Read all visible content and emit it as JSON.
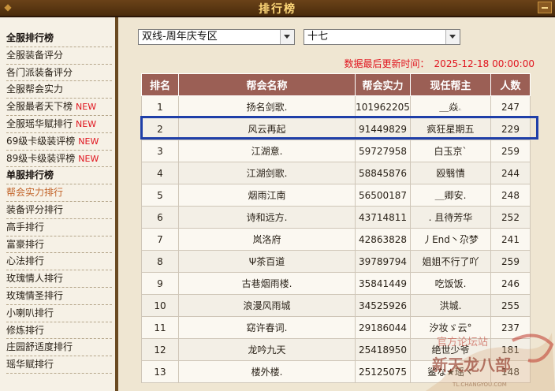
{
  "window": {
    "title": "排行榜"
  },
  "sidebar": {
    "items": [
      {
        "label": "全服排行榜",
        "type": "heading"
      },
      {
        "label": "全服装备评分"
      },
      {
        "label": "各门派装备评分"
      },
      {
        "label": "全服帮会实力"
      },
      {
        "label": "全服最者天下榜",
        "badge": "NEW"
      },
      {
        "label": "全服瑶华赋排行",
        "badge": "NEW"
      },
      {
        "label": "69级卡级装评榜",
        "badge": "NEW"
      },
      {
        "label": "89级卡级装评榜",
        "badge": "NEW"
      },
      {
        "label": "单服排行榜",
        "type": "heading"
      },
      {
        "label": "帮会实力排行",
        "active": true
      },
      {
        "label": "装备评分排行"
      },
      {
        "label": "高手排行"
      },
      {
        "label": "富豪排行"
      },
      {
        "label": "心法排行"
      },
      {
        "label": "玫瑰情人排行"
      },
      {
        "label": "玫瑰情圣排行"
      },
      {
        "label": "小喇叭排行"
      },
      {
        "label": "修炼排行"
      },
      {
        "label": "庄园舒适度排行"
      },
      {
        "label": "瑶华赋排行"
      }
    ]
  },
  "filters": {
    "server_group": "双线-周年庆专区",
    "server": "十七"
  },
  "update_info": {
    "label": "数据最后更新时间：",
    "time": "2025-12-18 00:00:00"
  },
  "table": {
    "columns": [
      "排名",
      "帮会名称",
      "帮会实力",
      "现任帮主",
      "人数"
    ],
    "rows": [
      [
        "1",
        "扬名剑歌.",
        "101962205",
        "＿焱ۦ",
        "247"
      ],
      [
        "2",
        "风云再起",
        "91449829",
        "疯狂星期五",
        "229"
      ],
      [
        "3",
        "江湖意.",
        "59727958",
        "白玉京`",
        "259"
      ],
      [
        "4",
        "江湖剑歌.",
        "58845876",
        "殴翳憒",
        "244"
      ],
      [
        "5",
        "烟雨江南",
        "56500187",
        "＿卿安.",
        "248"
      ],
      [
        "6",
        "诗和远方.",
        "43714811",
        ". 且待芳华",
        "252"
      ],
      [
        "7",
        "岚洛府",
        "42863828",
        "丿End丶尕梦",
        "241"
      ],
      [
        "8",
        "Ψ茶百道",
        "39789794",
        "姐姐不行了吖",
        "259"
      ],
      [
        "9",
        "古巷烟雨楼.",
        "35841449",
        "吃饭饭.",
        "246"
      ],
      [
        "10",
        "浪漫风雨城",
        "34525926",
        "洪城.",
        "255"
      ],
      [
        "11",
        "窈许春词.",
        "29186044",
        "汐妆ゞ云°",
        "237"
      ],
      [
        "12",
        "龙吟九天",
        "25418950",
        "绝世少爷",
        "181"
      ],
      [
        "13",
        "楼外楼.",
        "25125075",
        "鲨な★瑶ヾ",
        "148"
      ]
    ]
  },
  "watermark": {
    "line1": "官方论坛站",
    "line2": "新天龙八部",
    "url": "TL.CHANGYOU.COM"
  },
  "colors": {
    "header_bg": "#9b5f55",
    "accent_red": "#e0141e",
    "highlight_border": "#1f3fa8",
    "title_gold": "#ffd97a"
  }
}
